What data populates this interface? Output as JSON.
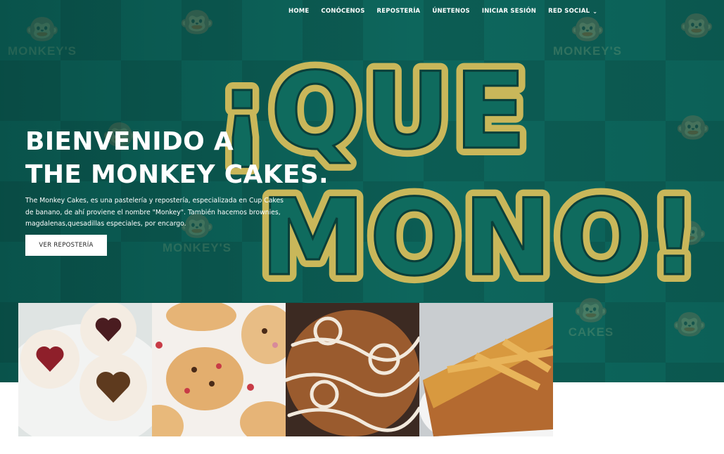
{
  "nav": {
    "items": [
      {
        "label": "HOME"
      },
      {
        "label": "CONÓCENOS"
      },
      {
        "label": "REPOSTERÍA"
      },
      {
        "label": "ÚNETENOS"
      },
      {
        "label": "INICIAR SESIÓN"
      },
      {
        "label": "RED SOCIAL"
      }
    ],
    "dropdown_icon": "chevron-down-icon"
  },
  "hero": {
    "title_line1": "BIENVENIDO A",
    "title_line2": "THE MONKEY CAKES.",
    "description": "The Monkey Cakes, es una pastelería y repostería, especializada en Cup Cakes de banano, de ahí proviene el nombre \"Monkey\". También hacemos brownies, magdalenas,quesadillas especiales, por encargo.",
    "button_label": "VER REPOSTERÍA",
    "background_text": {
      "slogan_line1": "¡QUE",
      "slogan_line2": "MONO!",
      "logo_word1": "MONKEY'S",
      "logo_word2": "CAKES"
    }
  },
  "gallery": {
    "images": [
      "linzer-cookies",
      "chocolate-chip-cookies",
      "cinnamon-rolls",
      "lattice-pie-slice"
    ]
  },
  "colors": {
    "hero_bg": "#0e6a60",
    "slogan_fill": "#c9b75a",
    "slogan_outline": "#0a3f3a",
    "text": "#ffffff"
  }
}
